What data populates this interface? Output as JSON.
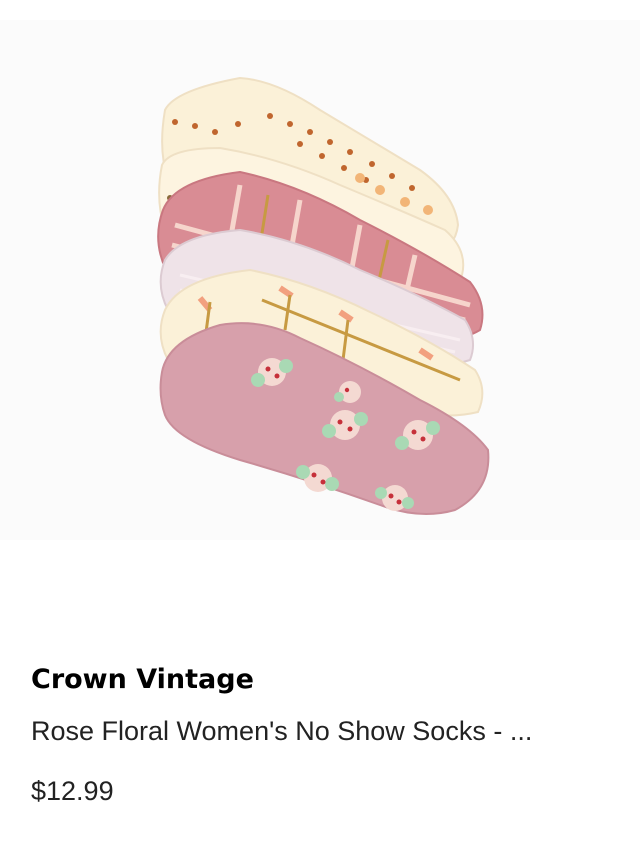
{
  "product": {
    "image_alt": "socks-multipack-icon",
    "brand": "Crown Vintage",
    "title": "Rose Floral Women's No Show Socks - ...",
    "price": "$12.99"
  },
  "colors": {
    "cream": "#fbf1d8",
    "pink_dark": "#d98c94",
    "pink_light": "#f4d5d2",
    "lavender": "#efe3e8",
    "floral_pink": "#d7a0ab",
    "mustard": "#c79a42",
    "coral": "#f2a07f",
    "mint": "#a9d9b4",
    "red_dot": "#c6303a"
  }
}
